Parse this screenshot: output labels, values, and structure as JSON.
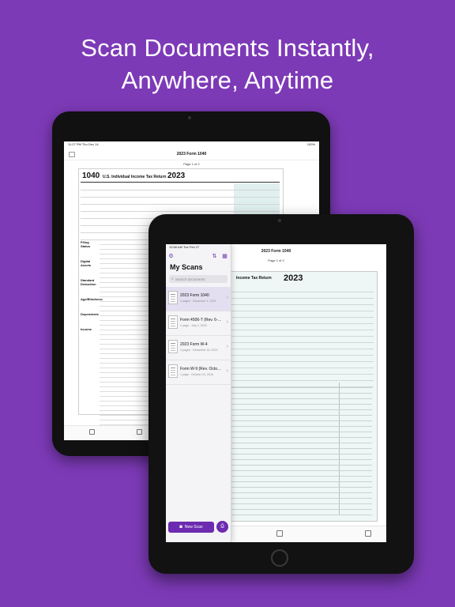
{
  "headline": {
    "line1": "Scan Documents Instantly,",
    "line2": "Anywhere, Anytime"
  },
  "back_ipad": {
    "status_time": "11:27 PM   Thu Dec 14",
    "status_right": "100%",
    "nav_title": "2023 Form 1040",
    "page_label": "Page 1 of 2",
    "form_number": "1040",
    "form_title": "U.S. Individual Income Tax Return",
    "form_year": "2023",
    "side_labels": [
      "Filing Status",
      "Digital Assets",
      "Standard Deduction",
      "Age/Blindness",
      "Dependents",
      "Income"
    ]
  },
  "front_ipad": {
    "status_time": "10:56 AM   Tue Feb 27",
    "status_right": "84%",
    "nav_title": "2023 Form 1040",
    "page_label": "Page 1 of 2",
    "form_title": "Income Tax Return",
    "form_year": "2023"
  },
  "sidebar": {
    "title": "My Scans",
    "search_placeholder": "Search documents",
    "items": [
      {
        "name": "2023 Form 1040",
        "meta": "2 pages · December 1, 2023"
      },
      {
        "name": "Form 4506-T (Rev. 6-20...",
        "meta": "1 page · July 3, 2023"
      },
      {
        "name": "2023 Form W-4",
        "meta": "4 pages · December 16, 2023"
      },
      {
        "name": "Form W-9 (Rev. October ...",
        "meta": "1 page · October 24, 2018"
      }
    ],
    "new_scan_label": "New Scan"
  },
  "colors": {
    "background": "#7d3ab7",
    "accent": "#6c2bb0",
    "form_tint": "#dff0ee"
  },
  "icons": [
    "sidebar-toggle-icon",
    "sort-icon",
    "grid-icon",
    "camera-icon",
    "document-scanner-icon",
    "share-icon",
    "edit-icon",
    "chevron-right-icon",
    "search-icon"
  ]
}
